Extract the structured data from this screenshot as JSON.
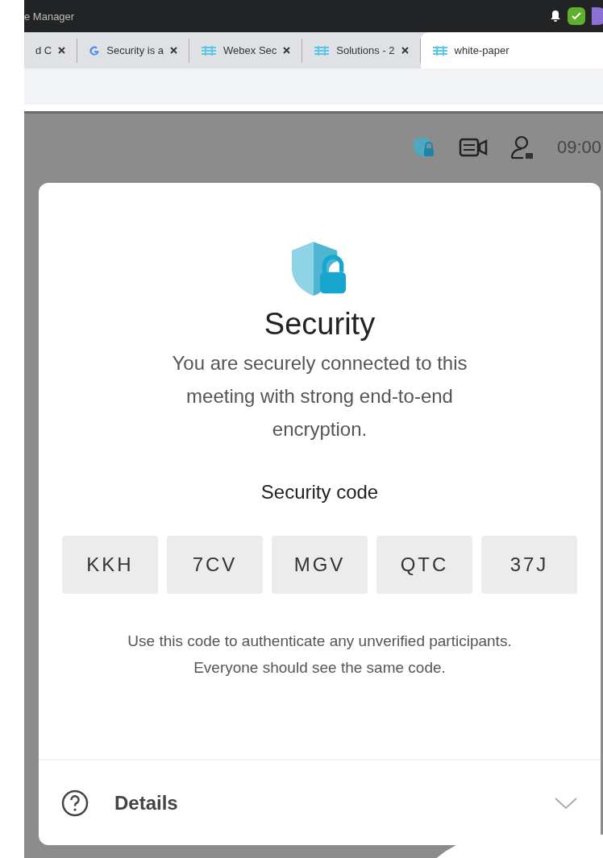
{
  "window": {
    "title": "e Manager"
  },
  "tabs": [
    {
      "label": "d C",
      "selected": false,
      "kind": "plain"
    },
    {
      "label": "Security is a",
      "selected": false,
      "kind": "google"
    },
    {
      "label": "Webex Sec",
      "selected": false,
      "kind": "webex"
    },
    {
      "label": "Solutions - 2",
      "selected": false,
      "kind": "webex"
    },
    {
      "label": "white-paper",
      "selected": true,
      "kind": "webex"
    }
  ],
  "toolbar": {
    "time": "09:00"
  },
  "dialog": {
    "title": "Security",
    "message": "You are securely connected to this meeting with strong end-to-end encryption.",
    "code_label": "Security code",
    "code": [
      "KKH",
      "7CV",
      "MGV",
      "QTC",
      "37J"
    ],
    "note": "Use this code to authenticate any unverified participants. Everyone should see the same code.",
    "details": {
      "label": "Details",
      "expanded": false
    }
  }
}
